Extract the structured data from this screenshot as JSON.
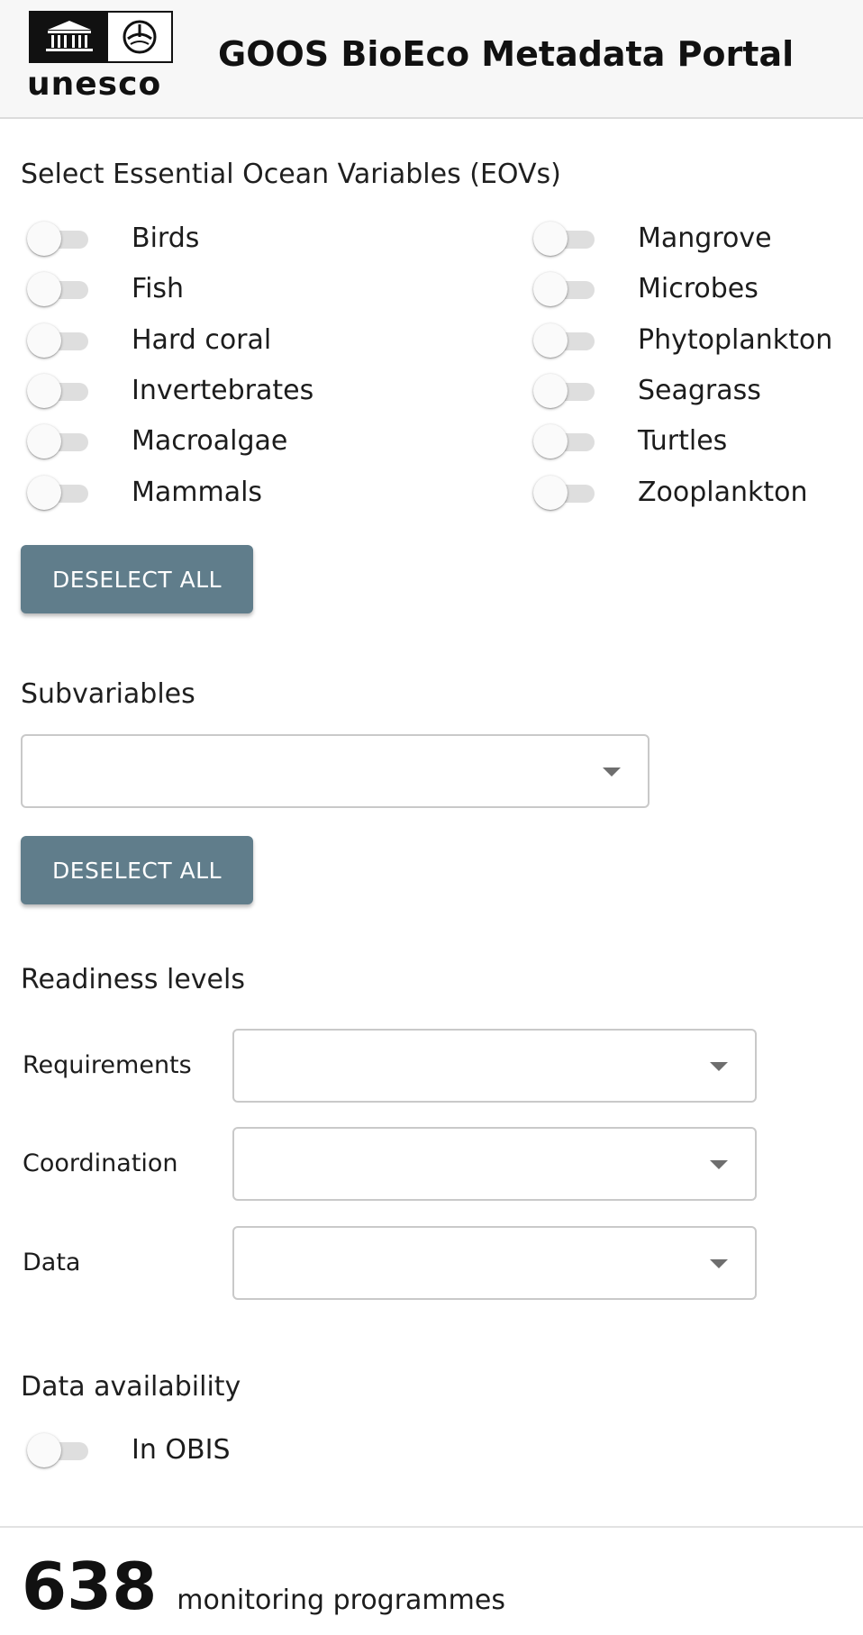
{
  "header": {
    "logo_text": "unesco",
    "title": "GOOS BioEco Metadata Portal"
  },
  "eov": {
    "title": "Select Essential Ocean Variables (EOVs)",
    "left": [
      {
        "label": "Birds",
        "on": false
      },
      {
        "label": "Fish",
        "on": false
      },
      {
        "label": "Hard coral",
        "on": false
      },
      {
        "label": "Invertebrates",
        "on": false
      },
      {
        "label": "Macroalgae",
        "on": false
      },
      {
        "label": "Mammals",
        "on": false
      }
    ],
    "right": [
      {
        "label": "Mangrove",
        "on": false
      },
      {
        "label": "Microbes",
        "on": false
      },
      {
        "label": "Phytoplankton",
        "on": false
      },
      {
        "label": "Seagrass",
        "on": false
      },
      {
        "label": "Turtles",
        "on": false
      },
      {
        "label": "Zooplankton",
        "on": false
      }
    ],
    "deselect_label": "DESELECT ALL"
  },
  "subvariables": {
    "title": "Subvariables",
    "value": "",
    "deselect_label": "DESELECT ALL"
  },
  "readiness": {
    "title": "Readiness levels",
    "fields": [
      {
        "label": "Requirements",
        "value": ""
      },
      {
        "label": "Coordination",
        "value": ""
      },
      {
        "label": "Data",
        "value": ""
      }
    ]
  },
  "availability": {
    "title": "Data availability",
    "toggle_label": "In OBIS",
    "on": false
  },
  "summary": {
    "count": "638",
    "label": "monitoring programmes"
  },
  "icons": {
    "logo_left": "unesco-temple-icon",
    "logo_right": "ioc-emblem-icon",
    "dropdown": "caret-down-icon"
  },
  "colors": {
    "button_bg": "#607d8b",
    "button_text": "#ffffff",
    "header_bg": "#f7f7f7",
    "toggle_track": "#dedede"
  }
}
